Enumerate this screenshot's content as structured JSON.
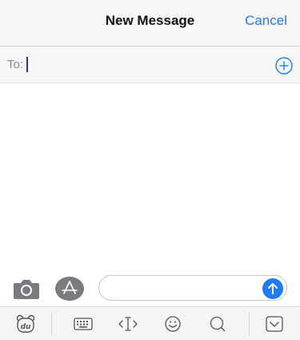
{
  "header": {
    "title": "New Message",
    "cancel_label": "Cancel"
  },
  "recipient": {
    "label": "To:",
    "value": "",
    "add_icon": "plus-circle-icon"
  },
  "composer": {
    "camera_icon": "camera-icon",
    "apps_icon": "app-store-icon",
    "message_value": "",
    "send_icon": "arrow-up-icon"
  },
  "keyboard_toolbar": {
    "items": [
      "du-logo-icon",
      "keyboard-icon",
      "cursor-move-icon",
      "emoji-icon",
      "search-icon",
      "collapse-keyboard-icon"
    ]
  },
  "colors": {
    "accent": "#1f7cf3",
    "nav_bg": "#f7f7f7",
    "icon_gray": "#6e6e73"
  }
}
